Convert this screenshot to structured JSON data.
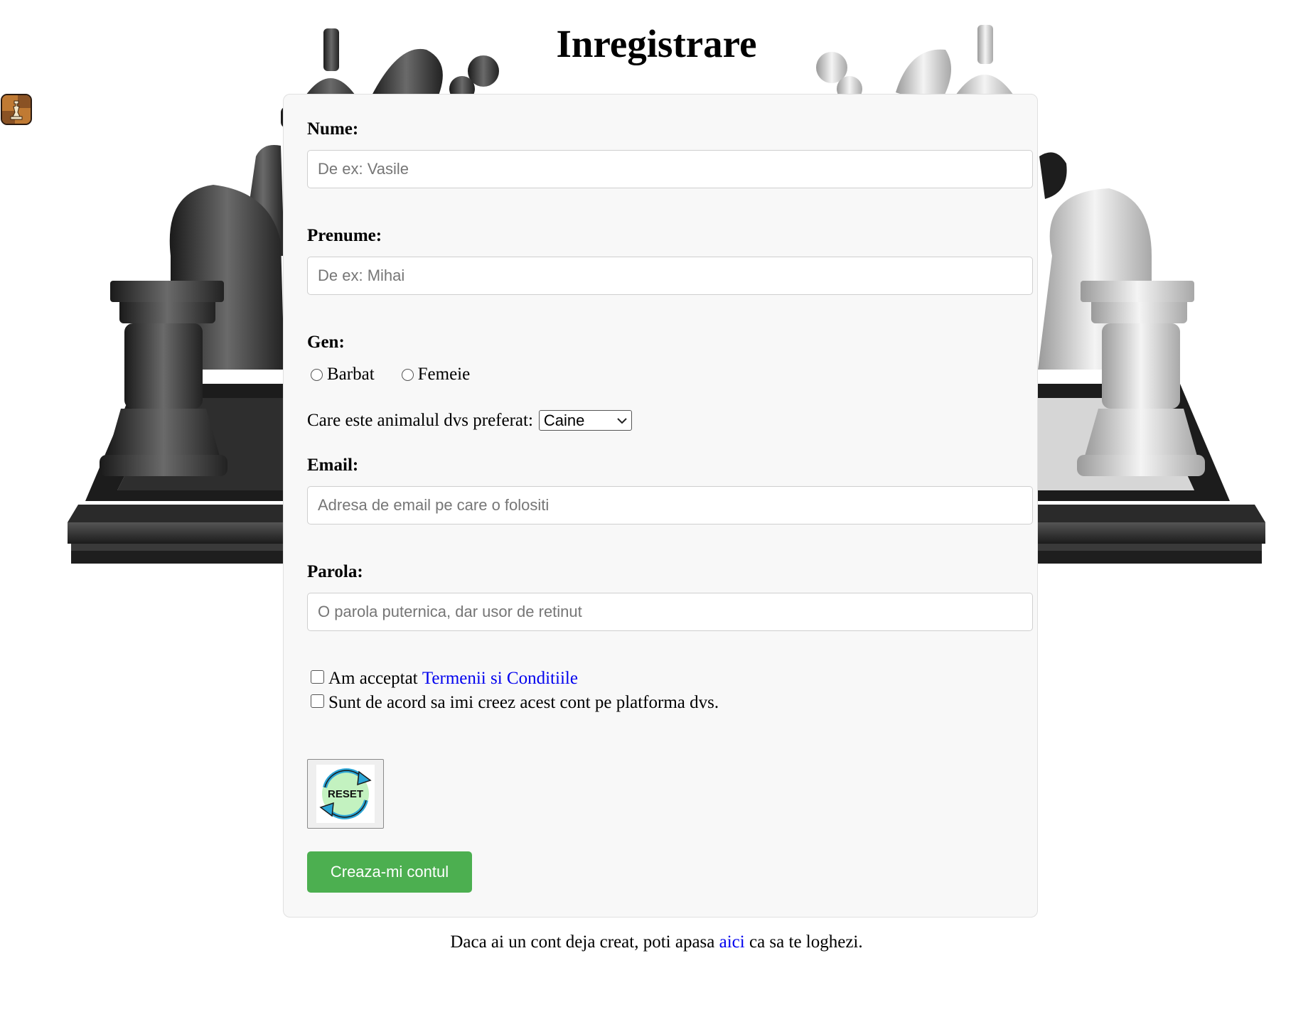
{
  "page": {
    "title": "Inregistrare"
  },
  "form": {
    "nume": {
      "label": "Nume:",
      "placeholder": "De ex: Vasile"
    },
    "prenume": {
      "label": "Prenume:",
      "placeholder": "De ex: Mihai"
    },
    "gen": {
      "label": "Gen:",
      "options": [
        "Barbat",
        "Femeie"
      ]
    },
    "animal": {
      "label": "Care este animalul dvs preferat:",
      "selected": "Caine"
    },
    "email": {
      "label": "Email:",
      "placeholder": "Adresa de email pe care o folositi"
    },
    "parola": {
      "label": "Parola:",
      "placeholder": "O parola puternica, dar usor de retinut"
    },
    "terms": {
      "prefix": "Am acceptat",
      "link": "Termenii si Conditiile"
    },
    "agree": {
      "label": "Sunt de acord sa imi creez acest cont pe platforma dvs."
    },
    "reset": {
      "label": "RESET"
    },
    "submit": {
      "label": "Creaza-mi contul"
    }
  },
  "footer": {
    "prefix": "Daca ai un cont deja creat, poti apasa",
    "link": "aici",
    "suffix": "ca sa te loghezi."
  },
  "colors": {
    "submit_bg": "#4caf50",
    "link": "#0000ee",
    "card_bg": "#f8f8f8"
  },
  "icons": {
    "app": "chess-king-icon",
    "reset": "reset-cycle-icon",
    "dropdown": "chevron-down-icon"
  }
}
